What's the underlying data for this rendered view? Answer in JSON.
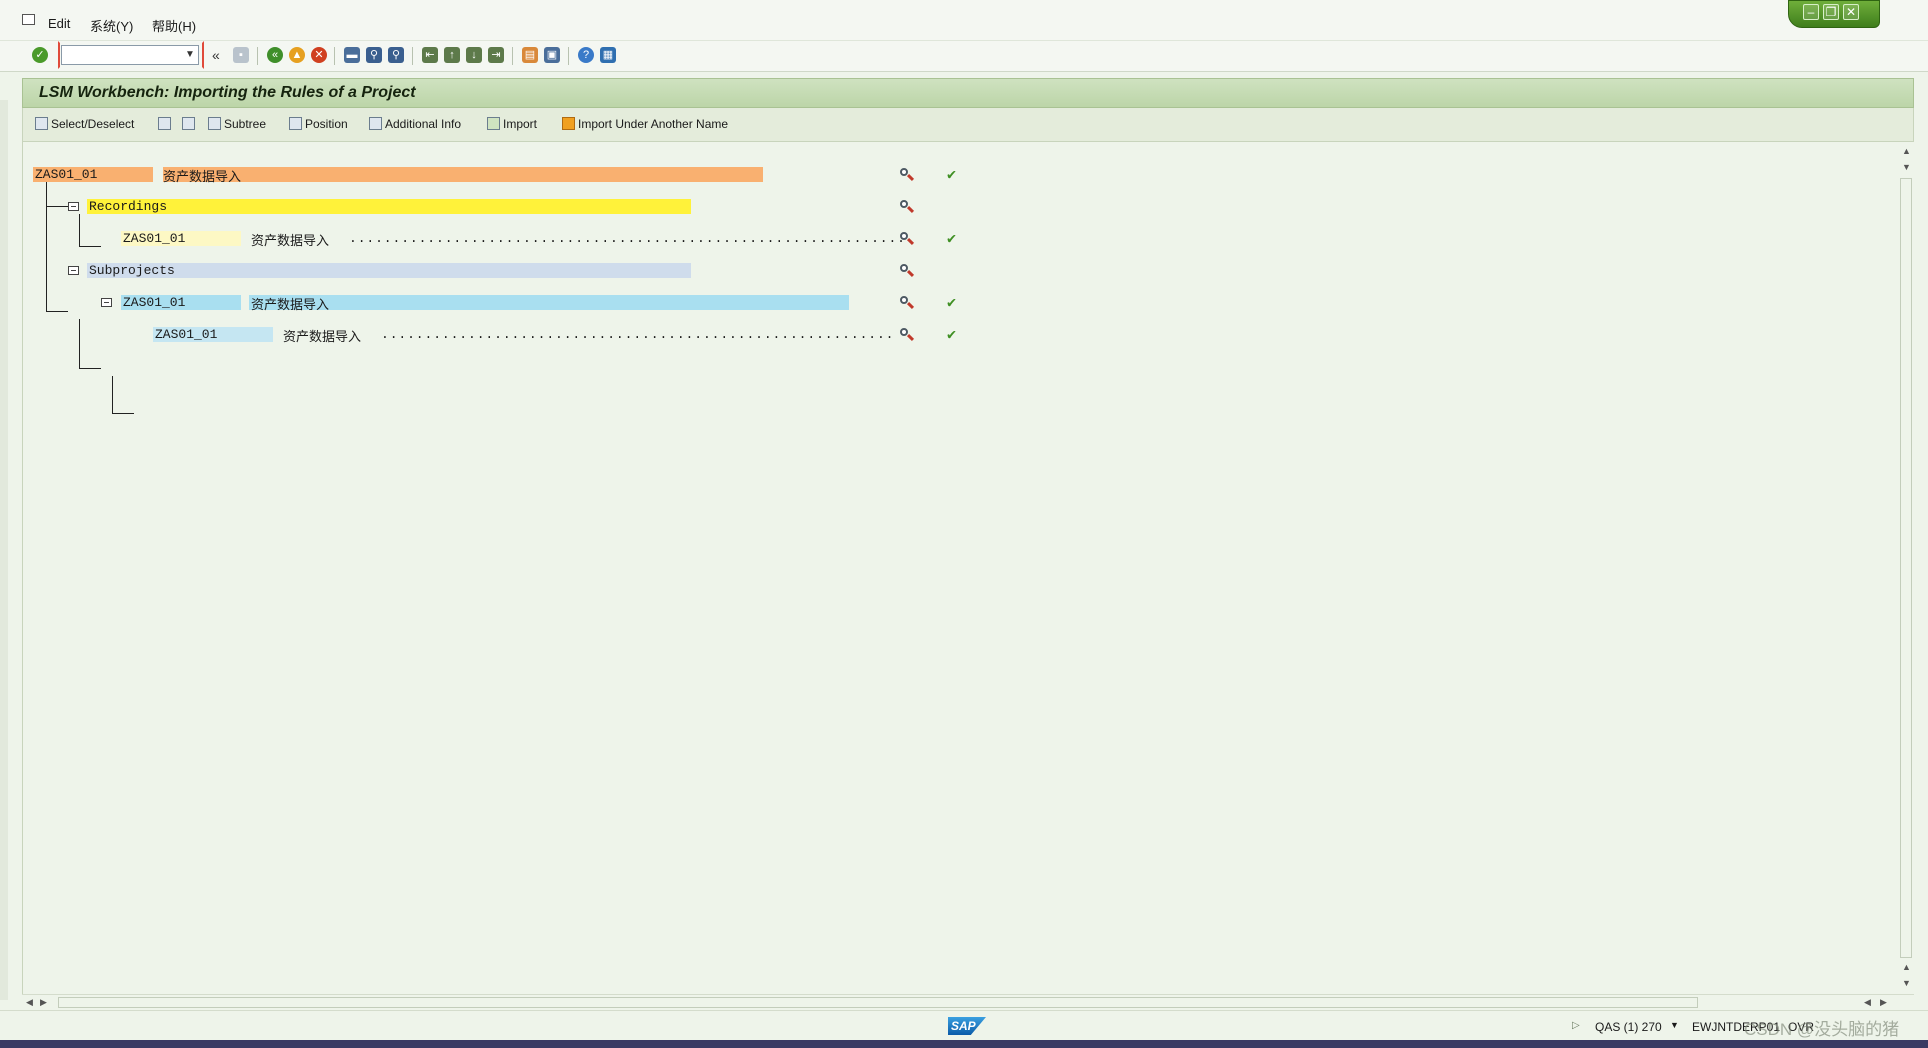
{
  "menu": {
    "items": [
      "Edit",
      "系统(Y)",
      "帮助(H)"
    ]
  },
  "toolbar": {
    "command_value": "",
    "history_label": "«"
  },
  "title": "LSM Workbench: Importing the Rules of a Project",
  "app_toolbar": {
    "select_deselect": "Select/Deselect",
    "subtree": "Subtree",
    "position": "Position",
    "additional_info": "Additional Info",
    "import": "Import",
    "import_under_another_name": "Import Under Another Name"
  },
  "tree": {
    "root": {
      "id": "ZAS01_01",
      "text": "资产数据导入",
      "color": "#f9b070",
      "checked": true
    },
    "recordings": {
      "label": "Recordings",
      "color": "#fff23a"
    },
    "recording_item": {
      "id": "ZAS01_01",
      "text": "资产数据导入",
      "dots": "................................................................",
      "color": "#fdf8c4",
      "checked": true
    },
    "subprojects": {
      "label": "Subprojects",
      "color": "#cfdcec"
    },
    "subproject": {
      "id": "ZAS01_01",
      "text": "资产数据导入",
      "color": "#a9dff0",
      "checked": true
    },
    "subproject_item": {
      "id": "ZAS01_01",
      "text": "资产数据导入",
      "dots": "...........................................................",
      "color": "#c5e6f2",
      "checked": true
    }
  },
  "status": {
    "system": "QAS (1) 270",
    "host": "EWJNTDERP01",
    "mode": "OVR",
    "watermark": "CSDN @没头脑的猪"
  },
  "colors": {
    "check": "#3f8f23",
    "title_bg": "#c5dcb3",
    "window_controls": "#4f8f28"
  }
}
